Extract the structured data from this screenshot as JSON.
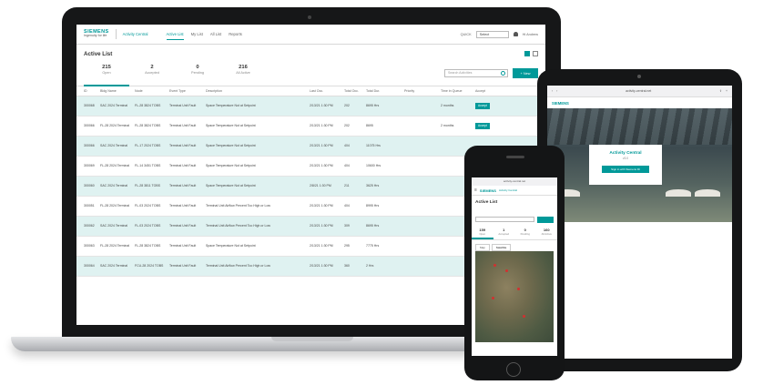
{
  "laptop": {
    "brand": "SIEMENS",
    "brand_sub": "Ingenuity for life",
    "app_name": "Activity Central",
    "tabs": [
      "Active List",
      "My List",
      "All List",
      "Reports"
    ],
    "quick_label": "QUICK",
    "quick_select": "Select",
    "user": "Hi Andrew",
    "page_title": "Active List",
    "stats": [
      {
        "num": "215",
        "label": "Open"
      },
      {
        "num": "2",
        "label": "Accepted"
      },
      {
        "num": "0",
        "label": "Pending"
      },
      {
        "num": "216",
        "label": "All Active"
      }
    ],
    "search_placeholder": "Search Activities",
    "new_button": "+ New",
    "columns": [
      "ID",
      "Bldg Name",
      "Node",
      "Event Type",
      "Description",
      "Last Occ.",
      "Total Occ.",
      "Total Dur.",
      "Priority",
      "Time in Queue",
      "Accept"
    ],
    "rows": [
      [
        "300068",
        "SAC 2024 Terminal",
        "FL-28 3824 TOBS",
        "Terminal Unit Fault",
        "Space Temperature Not at Setpoint",
        "2/13/21 1:30 PM",
        "202",
        "8695 Hrs",
        "",
        "2 months",
        "Accept"
      ],
      [
        "300066",
        "FL-28 2024 Terminal",
        "FL-28 3824 TOBS",
        "Terminal Unit Fault",
        "Space Temperature Not at Setpoint",
        "2/13/21 1:30 PM",
        "202",
        "8695",
        "",
        "2 months",
        "Accept"
      ],
      [
        "300066",
        "SAC 2024 Terminal",
        "FL-17 2024 TOBS",
        "Terminal Unit Fault",
        "Space Temperature Not at Setpoint",
        "2/13/21 1:30 PM",
        "404",
        "11075 Hrs",
        "",
        "",
        ""
      ],
      [
        "300069",
        "FL-28 2024 Terminal",
        "FL-14 3451 TOBS",
        "Terminal Unit Fault",
        "Space Temperature Not at Setpoint",
        "2/13/21 1:30 PM",
        "404",
        "10600 Hrs",
        "",
        "",
        ""
      ],
      [
        "300060",
        "SAC 2024 Terminal",
        "FL-28 3811 TOBS",
        "Terminal Unit Fault",
        "Space Temperature Not at Setpoint",
        "2/8/21 1:30 PM",
        "211",
        "3625 Hrs",
        "",
        "",
        ""
      ],
      [
        "300051",
        "FL-28 2024 Terminal",
        "FL-03 2024 TOBS",
        "Terminal Unit Fault",
        "Terminal Unit Airflow Percent Too High or Low",
        "2/13/21 1:30 PM",
        "404",
        "8995 Hrs",
        "",
        "",
        ""
      ],
      [
        "300062",
        "SAC 2024 Terminal",
        "FL-03 2024 TOBS",
        "Terminal Unit Fault",
        "Terminal Unit Airflow Percent Too High or Low",
        "2/13/21 1:30 PM",
        "309",
        "8695 Hrs",
        "",
        "",
        ""
      ],
      [
        "300063",
        "FL-28 2024 Terminal",
        "FL-28 3824 TOBS",
        "Terminal Unit Fault",
        "Space Temperature Not at Setpoint",
        "2/13/21 1:30 PM",
        "295",
        "7775 Hrs",
        "",
        "",
        ""
      ],
      [
        "300064",
        "SAC 2024 Terminal",
        "FCU-28 2024 TOBS",
        "Terminal Unit Fault",
        "Terminal Unit Airflow Percent Too High or Low",
        "2/13/21 1:30 PM",
        "360",
        "2 Hrs",
        "",
        "",
        ""
      ]
    ]
  },
  "tablet": {
    "url": "activity-central.net",
    "brand": "SIEMENS",
    "card_title": "Activity Central",
    "card_sub": "v3.0",
    "card_button": "Sign in with Siemens ID"
  },
  "phone": {
    "url": "activity-central.net",
    "brand": "SIEMENS",
    "app_name": "Activity Central",
    "title": "Active List",
    "stats": [
      {
        "num": "159",
        "label": "Open"
      },
      {
        "num": "1",
        "label": "Accepted"
      },
      {
        "num": "0",
        "label": "Pending"
      },
      {
        "num": "160",
        "label": "All Active"
      }
    ],
    "map_tabs": [
      "Map",
      "Satellite"
    ]
  }
}
